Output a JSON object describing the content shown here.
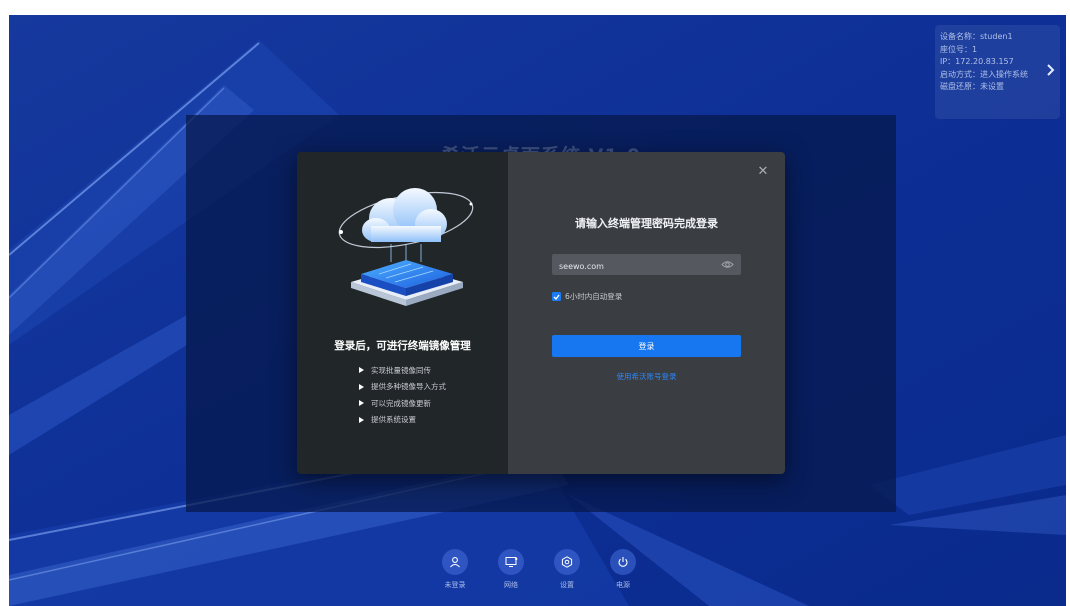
{
  "device_info": {
    "rows": [
      "设备名称：studen1",
      "座位号：1",
      "IP：172.20.83.157",
      "启动方式：进入操作系统",
      "磁盘还原：未设置"
    ],
    "arrow_icon": "chevron-right-icon"
  },
  "backdrop": {
    "title": "希沃云桌面系统 V1.0"
  },
  "dialog": {
    "left": {
      "title": "登录后，可进行终端镜像管理",
      "features": [
        "实现批量镜像同传",
        "提供多种镜像导入方式",
        "可以完成镜像更新",
        "提供系统设置"
      ]
    },
    "right": {
      "title": "请输入终端管理密码完成登录",
      "password_value": "seewo.com",
      "remember_label": "6小时内自动登录",
      "remember_checked": true,
      "login_label": "登录",
      "alt_login_label": "使用希沃账号登录"
    }
  },
  "dock": {
    "items": [
      {
        "label": "未登录",
        "icon": "user-icon"
      },
      {
        "label": "网络",
        "icon": "network-icon"
      },
      {
        "label": "设置",
        "icon": "settings-icon"
      },
      {
        "label": "电源",
        "icon": "power-icon"
      }
    ]
  },
  "colors": {
    "desktop_bg": "#0c2f9a",
    "accent": "#1677f0",
    "dialog_left": "#212628",
    "dialog_right": "#3a3d42"
  }
}
